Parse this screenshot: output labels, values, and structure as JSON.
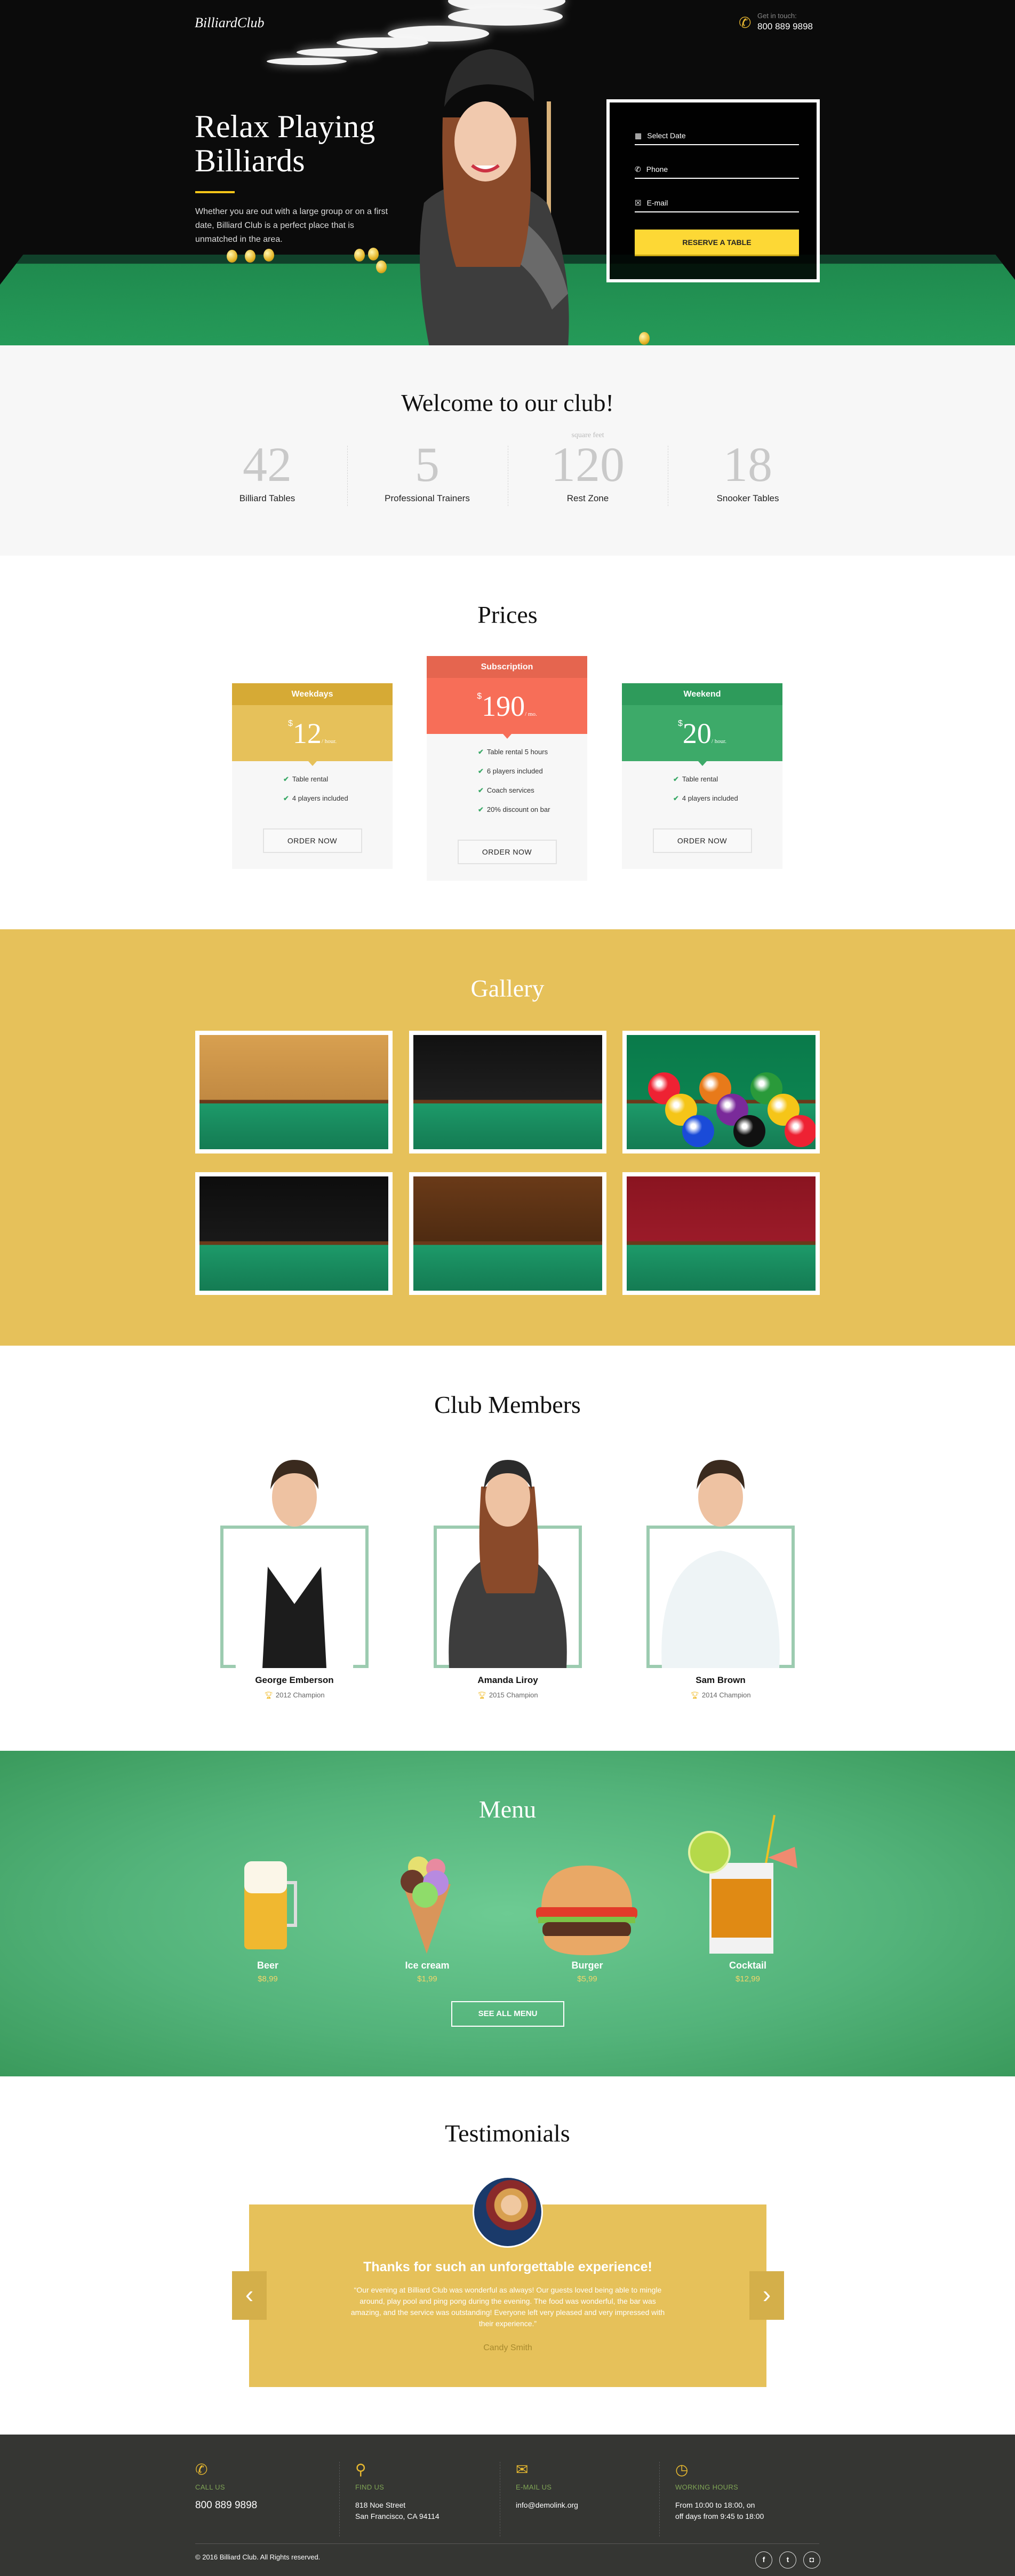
{
  "header": {
    "logo": "BilliardClub",
    "contact_label": "Get in touch:",
    "phone": "800 889 9898"
  },
  "hero": {
    "title_line1": "Relax Playing",
    "title_line2": "Billiards",
    "description": "Whether you are out with a large group or on a first date, Billiard Club is a perfect place that is unmatched in the area.",
    "form": {
      "date_placeholder": "Select Date",
      "phone_placeholder": "Phone",
      "email_placeholder": "E-mail",
      "submit": "RESERVE A TABLE"
    }
  },
  "welcome": {
    "title": "Welcome to our club!",
    "stats": [
      {
        "value": "42",
        "label": "Billiard Tables",
        "note": ""
      },
      {
        "value": "5",
        "label": "Professional Trainers",
        "note": ""
      },
      {
        "value": "120",
        "label": "Rest Zone",
        "note": "square feet"
      },
      {
        "value": "18",
        "label": "Snooker Tables",
        "note": ""
      }
    ]
  },
  "prices": {
    "title": "Prices",
    "plans": [
      {
        "name": "Weekdays",
        "currency": "$",
        "amount": "12",
        "period": "/ hour.",
        "features": [
          "Table rental",
          "4 players included"
        ],
        "button": "ORDER NOW",
        "color": "#e6c15a",
        "header_color": "#d6aa35"
      },
      {
        "name": "Subscription",
        "currency": "$",
        "amount": "190",
        "period": "/ mo.",
        "features": [
          "Table rental 5 hours",
          "6 players included",
          "Coach services",
          "20% discount on bar"
        ],
        "button": "ORDER NOW",
        "color": "#f76e58",
        "header_color": "#e5654f"
      },
      {
        "name": "Weekend",
        "currency": "$",
        "amount": "20",
        "period": "/ hour.",
        "features": [
          "Table rental",
          "4 players included"
        ],
        "button": "ORDER NOW",
        "color": "#3daa69",
        "header_color": "#2e9b5b"
      }
    ]
  },
  "gallery": {
    "title": "Gallery",
    "background": "#e6c15a"
  },
  "members": {
    "title": "Club Members",
    "list": [
      {
        "name": "George Emberson",
        "award": "2012 Champion"
      },
      {
        "name": "Amanda Liroy",
        "award": "2015 Champion"
      },
      {
        "name": "Sam Brown",
        "award": "2014 Champion"
      }
    ]
  },
  "menu": {
    "title": "Menu",
    "items": [
      {
        "name": "Beer",
        "price": "$8,99"
      },
      {
        "name": "Ice cream",
        "price": "$1,99"
      },
      {
        "name": "Burger",
        "price": "$5,99"
      },
      {
        "name": "Cocktail",
        "price": "$12,99"
      }
    ],
    "button": "SEE ALL MENU"
  },
  "testimonials": {
    "title": "Testimonials",
    "heading": "Thanks for such an unforgettable experience!",
    "quote": "“Our evening at Billiard Club was wonderful as always! Our guests loved being able to mingle around, play pool and ping pong during the evening. The food was wonderful, the bar was amazing, and the service was outstanding! Everyone left very pleased and very impressed with their experience.”",
    "author": "Candy Smith"
  },
  "footer": {
    "columns": [
      {
        "icon": "phone-icon",
        "label": "CALL US",
        "lines": [
          "800 889 9898"
        ]
      },
      {
        "icon": "map-pin-icon",
        "label": "FIND US",
        "lines": [
          "818 Noe Street",
          "San Francisco, CA 94114"
        ]
      },
      {
        "icon": "envelope-icon",
        "label": "E-MAIL US",
        "lines": [
          "info@demolink.org"
        ]
      },
      {
        "icon": "clock-icon",
        "label": "WORKING HOURS",
        "lines": [
          "From 10:00 to 18:00, on",
          "off days from 9:45 to 18:00"
        ]
      }
    ],
    "copyright": "© 2016 Billiard Club. All Rights reserved.",
    "social": [
      {
        "icon": "facebook-icon",
        "glyph": "f"
      },
      {
        "icon": "twitter-icon",
        "glyph": "t"
      },
      {
        "icon": "instagram-icon",
        "glyph": "◘"
      }
    ]
  }
}
